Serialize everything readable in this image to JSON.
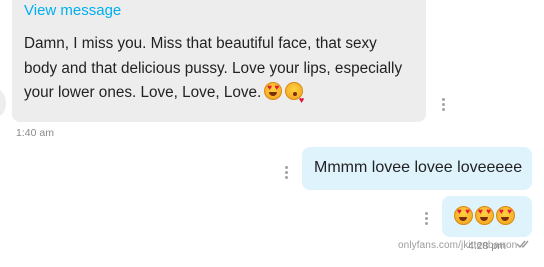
{
  "incoming_message": {
    "view_message_label": "View message",
    "text": "Damn, I miss you. Miss that beautiful face, that sexy body and that delicious pussy. Love your lips, especially your lower ones. Love, Love, Love.",
    "emojis": [
      "heart-eyes",
      "kissing-heart"
    ],
    "timestamp": "1:40 am"
  },
  "outgoing_messages": [
    {
      "text": "Mmmm lovee lovee loveeeee"
    },
    {
      "emojis": [
        "heart-eyes",
        "heart-eyes",
        "heart-eyes"
      ]
    }
  ],
  "outgoing_timestamp": "4:28 pm",
  "watermark": "onlyfans.com/jkittenbarron",
  "colors": {
    "link": "#00aff0",
    "incoming_bubble": "#ededee",
    "outgoing_bubble": "#dff3fd"
  }
}
